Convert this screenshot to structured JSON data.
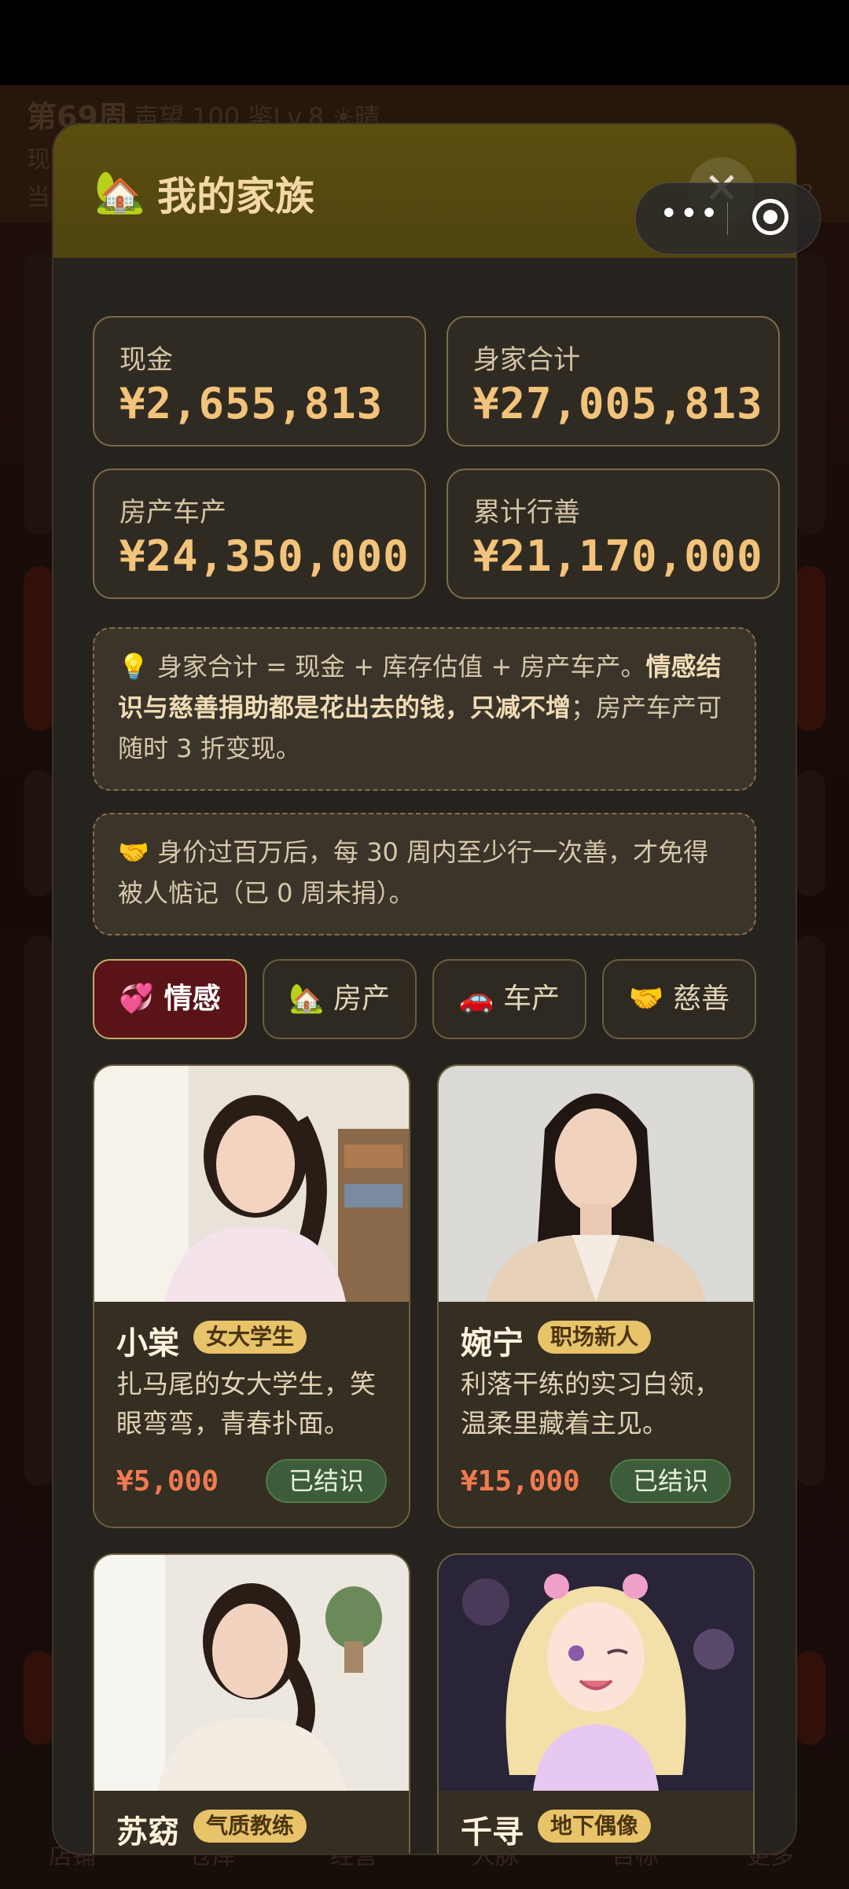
{
  "background": {
    "week": "第69周",
    "fame": "声望 100 鉴Lv.8 ☀晴",
    "line2": "现",
    "line3": "当",
    "right_text": "22",
    "nav": [
      "店铺",
      "仓库",
      "经营",
      "人脉",
      "目标",
      "更多"
    ]
  },
  "capsule": {
    "more_label": "•••"
  },
  "modal": {
    "icon": "house-icon",
    "title_emoji": "🏡",
    "title": "我的家族",
    "close_label": "✕"
  },
  "stats": [
    {
      "label": "现金",
      "value": "¥2,655,813"
    },
    {
      "label": "身家合计",
      "value": "¥27,005,813"
    },
    {
      "label": "房产车产",
      "value": "¥24,350,000"
    },
    {
      "label": "累计行善",
      "value": "¥21,170,000"
    }
  ],
  "notes": {
    "wealth_emoji": "💡",
    "wealth_plain1": " 身家合计 = 现金 + 库存估值 + 房产车产。",
    "wealth_bold": "情感结识与慈善捐助都是花出去的钱，只减不增",
    "wealth_plain2": "；房产车产可随时 3 折变现。",
    "charity_emoji": "🤝",
    "charity_text": " 身价过百万后，每 30 周内至少行一次善，才免得被人惦记（已 0 周未捐）。"
  },
  "tabs": [
    {
      "emoji": "💞",
      "label": "情感",
      "active": true
    },
    {
      "emoji": "🏡",
      "label": "房产",
      "active": false
    },
    {
      "emoji": "🚗",
      "label": "车产",
      "active": false
    },
    {
      "emoji": "🤝",
      "label": "慈善",
      "active": false
    }
  ],
  "cards": [
    {
      "name": "小棠",
      "tag": "女大学生",
      "desc": "扎马尾的女大学生，笑眼弯弯，青春扑面。",
      "price": "¥5,000",
      "status": "已结识"
    },
    {
      "name": "婉宁",
      "tag": "职场新人",
      "desc": "利落干练的实习白领，温柔里藏着主见。",
      "price": "¥15,000",
      "status": "已结识"
    },
    {
      "name": "苏窈",
      "tag": "气质教练"
    },
    {
      "name": "千寻",
      "tag": "地下偶像"
    }
  ],
  "colors": {
    "accent_gold": "#f2c37a",
    "price_red": "#f07a52",
    "active_tab": "#5a1418",
    "tag_bg": "#e8c36a",
    "status_green": "#3d5c3a"
  }
}
